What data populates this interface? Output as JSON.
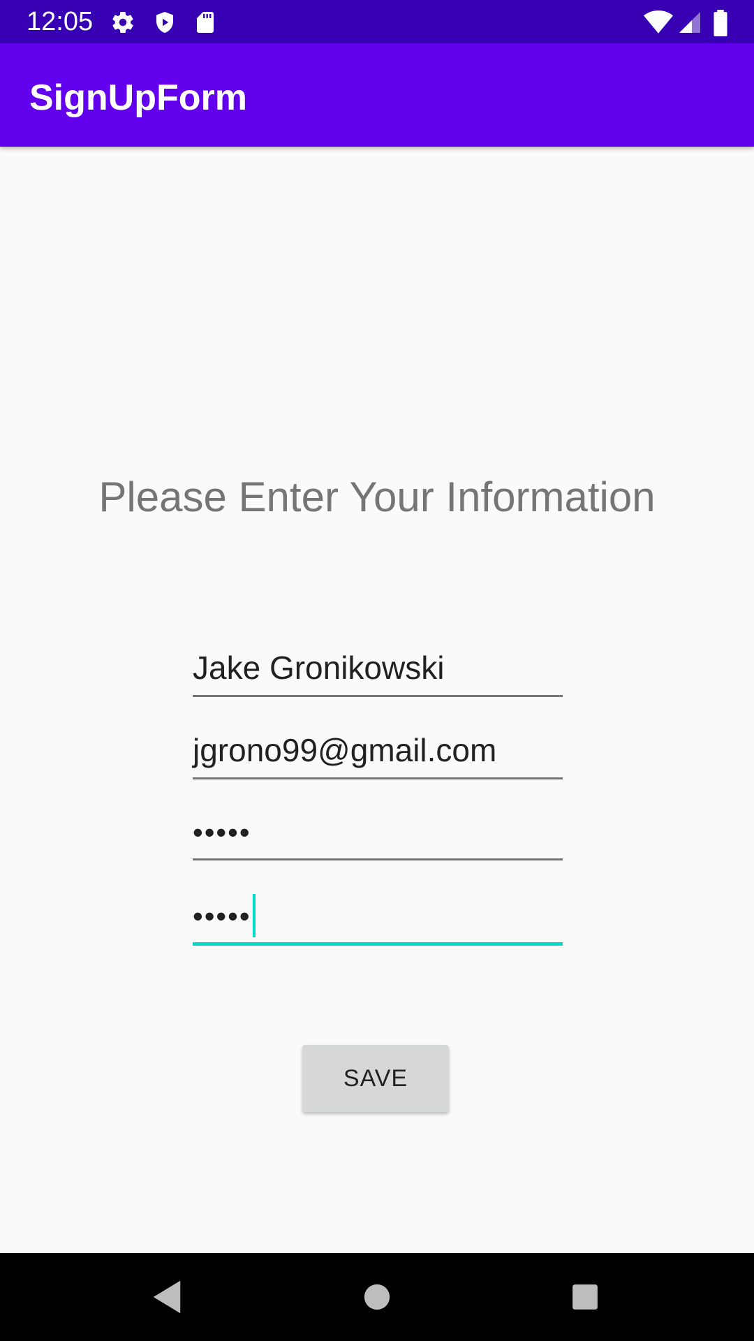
{
  "status_bar": {
    "time": "12:05",
    "left_icons": [
      "gear-icon",
      "shield-icon",
      "sd-card-icon"
    ],
    "right_icons": [
      "wifi-icon",
      "signal-icon",
      "battery-icon"
    ],
    "background": "#3700b3"
  },
  "app_bar": {
    "title": "SignUpForm",
    "background": "#6200ee"
  },
  "form": {
    "heading": "Please Enter Your Information",
    "name_value": "Jake Gronikowski",
    "email_value": "jgrono99@gmail.com",
    "password_value": "•••••",
    "confirm_password_value": "•••••",
    "focus_color": "#03dac5"
  },
  "actions": {
    "save_label": "SAVE"
  },
  "nav_bar": {
    "buttons": [
      "back-icon",
      "home-icon",
      "recents-icon"
    ]
  }
}
